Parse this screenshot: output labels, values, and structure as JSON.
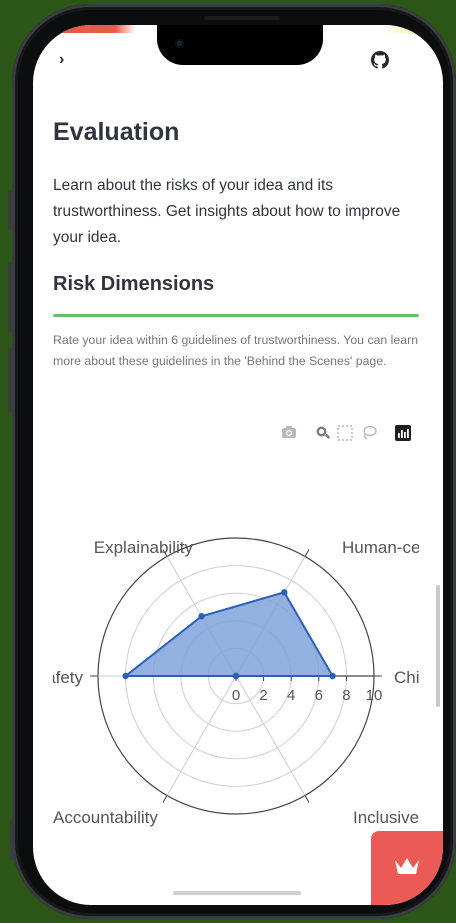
{
  "page": {
    "title": "Evaluation",
    "intro": "Learn about the risks of your idea and its trustworthiness. Get insights about how to improve your idea.",
    "section_title": "Risk Dimensions",
    "section_caption": "Rate your idea within 6 guidelines of trustworthiness. You can learn more about these guidelines in the 'Behind the Scenes' page."
  },
  "topbar": {
    "sidebar_toggle_icon": "chevron-right-icon",
    "repo_icon": "github-icon"
  },
  "modebar": [
    "camera-icon",
    "zoom-icon",
    "box-select-icon",
    "lasso-icon",
    "plotly-logo-icon"
  ],
  "colors": {
    "accent_divider": "#64c06a",
    "fill": "#7fa3dc",
    "line": "#2c5fb8",
    "badge": "#ec5a56"
  },
  "chart_data": {
    "type": "radar",
    "categories": [
      "Human-centred",
      "Child",
      "Inclusive Grow",
      "Accountability",
      "Safety",
      "Explainability"
    ],
    "category_labels_visible": [
      "Human-centre",
      "Chilc",
      "Inclusive Grow",
      "Accountability",
      "afety",
      "Explainability"
    ],
    "values": [
      7,
      7,
      0,
      0,
      8,
      5
    ],
    "radial_ticks": [
      0,
      2,
      4,
      6,
      8,
      10
    ],
    "radial_range": [
      0,
      10
    ],
    "grid": true
  }
}
